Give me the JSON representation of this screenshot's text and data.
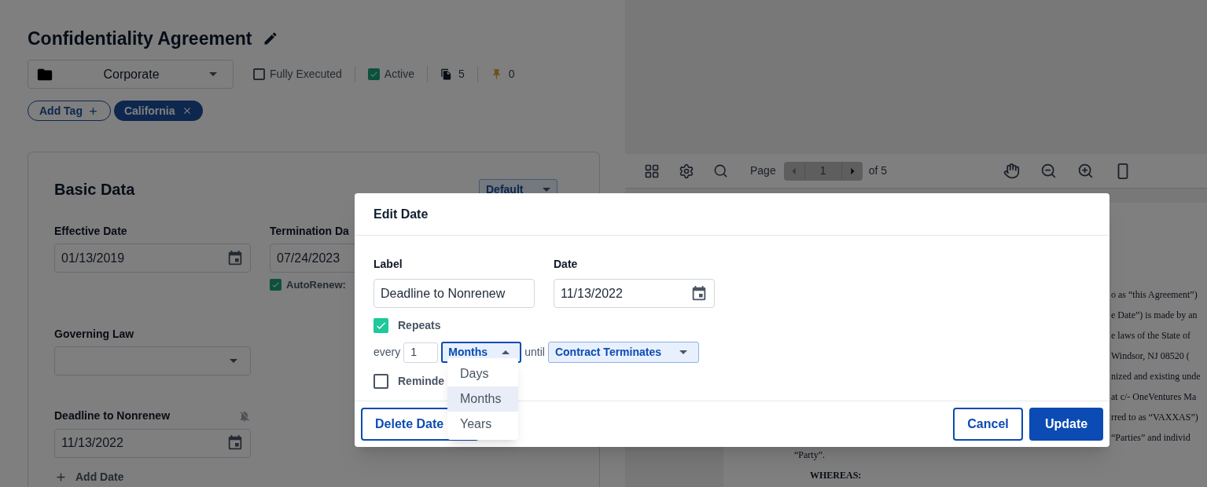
{
  "title": "Confidentiality Agreement",
  "folder": {
    "value": "Corporate"
  },
  "flags": [
    {
      "label": "Fully Executed",
      "checked": false
    },
    {
      "label": "Active",
      "checked": true
    }
  ],
  "counts": [
    {
      "kind": "documents",
      "value": "5"
    },
    {
      "kind": "pins",
      "value": "0"
    }
  ],
  "tags": [
    {
      "kind": "add",
      "label": "Add Tag"
    },
    {
      "kind": "tag",
      "label": "California"
    }
  ],
  "basic_data": {
    "title": "Basic Data",
    "view_select": "Default",
    "fields": [
      {
        "kind": "date",
        "label": "Effective Date",
        "value": "01/13/2019"
      },
      {
        "kind": "date",
        "label": "Termination Da",
        "value": "07/24/2023",
        "autorenew": {
          "label": "AutoRenew:",
          "checked": true
        }
      },
      {
        "kind": "select",
        "label": "Governing Law"
      },
      {
        "kind": "spacer"
      },
      {
        "kind": "date",
        "label": "Deadline to Nonrenew",
        "value": "11/13/2022",
        "reminder_off": true
      }
    ],
    "add_date": "Add Date"
  },
  "viewer": {
    "page_label": "Page",
    "page": "1",
    "page_count": "of 5",
    "document_lines": [
      "o as “this Agreement”)",
      "e Date”) is made by an",
      "e laws of the State of",
      "Windsor, NJ 08520 (",
      "nized and existing unde",
      "at c/- OneVentures Ma",
      "rred to as “VAXXAS”)",
      "“Parties” and individ"
    ],
    "document_tail": [
      "“Party”.",
      "WHEREAS:"
    ]
  },
  "dialog": {
    "title": "Edit Date",
    "label_field": {
      "label": "Label",
      "value": "Deadline to Nonrenew"
    },
    "date_field": {
      "label": "Date",
      "value": "11/13/2022"
    },
    "repeats": {
      "label": "Repeats",
      "checked": true
    },
    "every": "every",
    "interval": "1",
    "unit": {
      "value": "Months",
      "expanded": true
    },
    "until": "until",
    "until_value": "Contract Terminates",
    "reminder": {
      "label": "Reminde",
      "checked": false
    },
    "unit_options": [
      {
        "label": "Days",
        "selected": false
      },
      {
        "label": "Months",
        "selected": true
      },
      {
        "label": "Years",
        "selected": false
      }
    ],
    "buttons": [
      {
        "kind": "delete",
        "label": "Delete Date"
      },
      {
        "kind": "cancel",
        "label": "Cancel"
      },
      {
        "kind": "primary",
        "label": "Update"
      }
    ]
  }
}
